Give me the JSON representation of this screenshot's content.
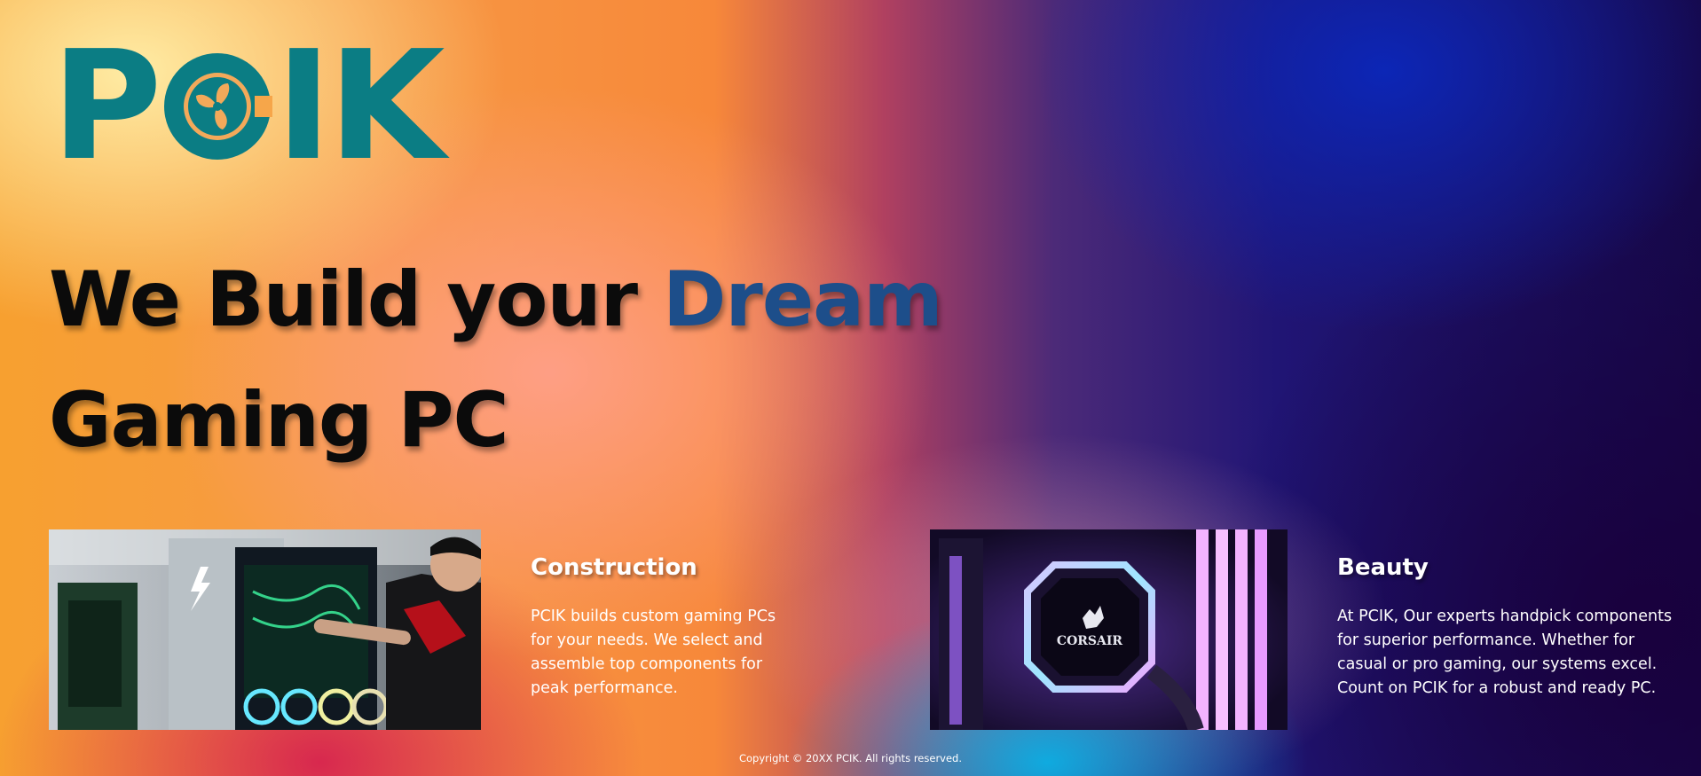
{
  "brand": {
    "logo_left": "P",
    "logo_right": "IK",
    "logo_icon": "fan-icon",
    "color": "#0b7d84"
  },
  "hero": {
    "title_part1": "We Build your ",
    "title_accent": "Dream",
    "title_line2": "Gaming PC",
    "accent_color": "#1d4e8a"
  },
  "sections": [
    {
      "image_icon": "technician-building-pc-photo",
      "title": "Construction",
      "body": "PCIK builds custom gaming PCs for your needs. We select and assemble top components for peak performance."
    },
    {
      "image_icon": "rgb-liquid-cooler-photo",
      "image_label": "CORSAIR",
      "title": "Beauty",
      "body": "At PCIK, Our experts handpick components for superior performance. Whether for casual or pro gaming, our systems excel. Count on PCIK for a robust and ready PC."
    }
  ],
  "footer": {
    "copyright": "Copyright © 20XX PCIK. All rights reserved."
  }
}
